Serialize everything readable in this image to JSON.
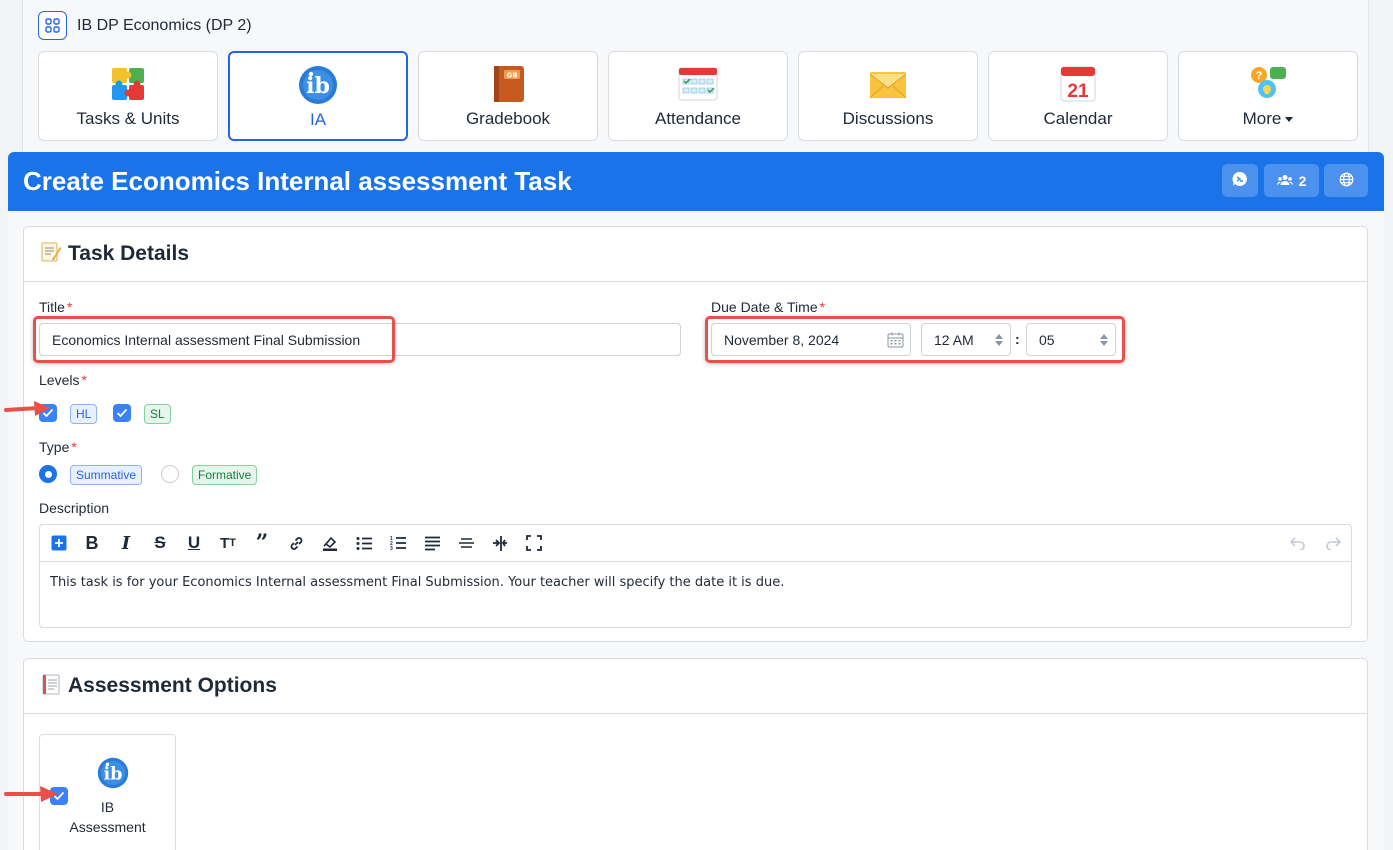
{
  "course": {
    "title": "IB DP Economics (DP 2)",
    "icon": "grid-icon"
  },
  "nav_tiles": [
    {
      "label": "Tasks & Units",
      "icon": "puzzle-icon",
      "active": false
    },
    {
      "label": "IA",
      "icon": "ib-logo-icon",
      "active": true
    },
    {
      "label": "Gradebook",
      "icon": "gradebook-icon",
      "active": false
    },
    {
      "label": "Attendance",
      "icon": "attendance-icon",
      "active": false
    },
    {
      "label": "Discussions",
      "icon": "envelope-icon",
      "active": false
    },
    {
      "label": "Calendar",
      "icon": "calendar-icon",
      "active": false
    },
    {
      "label": "More",
      "icon": "help-bubbles-icon",
      "active": false
    }
  ],
  "calendar_day": "21",
  "gradebook_badge": "GB",
  "header": {
    "title": "Create Economics Internal assessment Task",
    "members_count": "2",
    "accent": "#1a73e8"
  },
  "task_details": {
    "heading": "Task Details",
    "title_label": "Title",
    "title_value": "Economics Internal assessment Final Submission",
    "due_label": "Due Date & Time",
    "due_date": "November 8, 2024",
    "due_hour": "12 AM",
    "time_separator": ":",
    "due_minute": "05",
    "levels_label": "Levels",
    "levels": [
      {
        "label": "HL",
        "checked": true
      },
      {
        "label": "SL",
        "checked": true
      }
    ],
    "type_label": "Type",
    "types": [
      {
        "label": "Summative",
        "selected": true
      },
      {
        "label": "Formative",
        "selected": false
      }
    ],
    "description_label": "Description",
    "description_text": "This task is for your Economics Internal assessment Final Submission. Your teacher will specify the date it is due."
  },
  "assessment_options": {
    "heading": "Assessment Options",
    "option_line1": "IB",
    "option_line2": "Assessment",
    "checked": true
  },
  "required_marker": "*",
  "highlight_color": "#e8504a"
}
